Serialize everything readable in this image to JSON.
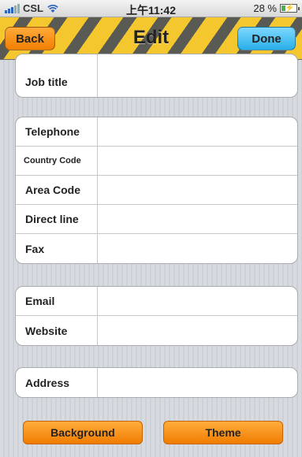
{
  "status_bar": {
    "carrier": "CSL",
    "time": "上午11:42",
    "battery": "28 %",
    "battery_level": 0.28
  },
  "nav": {
    "title": "Edit",
    "back_label": "Back",
    "done_label": "Done"
  },
  "groups": {
    "job": [
      {
        "label": "Job title"
      }
    ],
    "phone": [
      {
        "label": "Telephone"
      },
      {
        "label": "Country Code"
      },
      {
        "label": "Area Code"
      },
      {
        "label": "Direct line"
      },
      {
        "label": "Fax"
      }
    ],
    "web": [
      {
        "label": "Email"
      },
      {
        "label": "Website"
      }
    ],
    "address": [
      {
        "label": "Address"
      }
    ]
  },
  "buttons": {
    "background_label": "Background",
    "theme_label": "Theme"
  },
  "colors": {
    "orange_button": "#f17e00",
    "blue_button": "#28aee8",
    "stripe_yellow": "#f5c72e",
    "stripe_gray": "#5a5a55"
  }
}
